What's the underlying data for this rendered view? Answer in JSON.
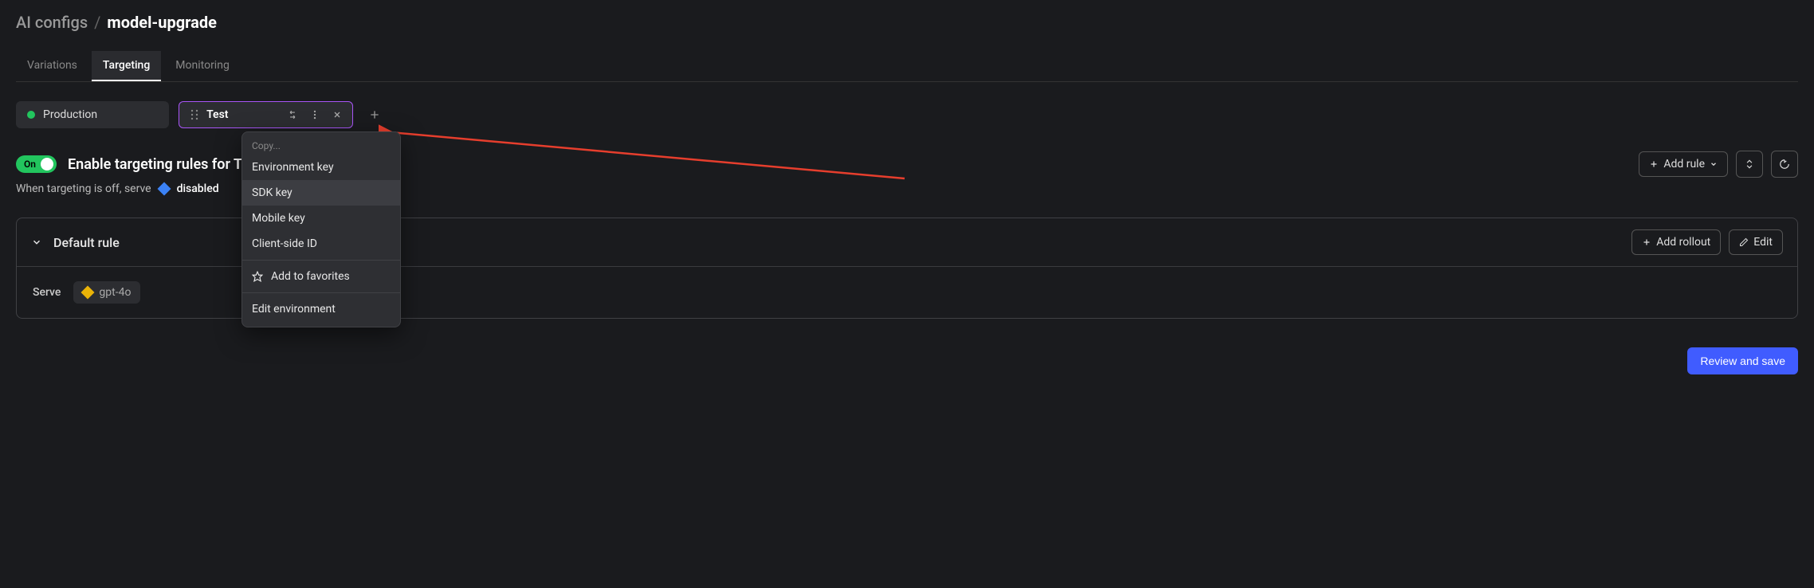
{
  "breadcrumb": {
    "parent": "AI configs",
    "sep": "/",
    "current": "model-upgrade"
  },
  "tabs": [
    {
      "label": "Variations",
      "active": false
    },
    {
      "label": "Targeting",
      "active": true
    },
    {
      "label": "Monitoring",
      "active": false
    }
  ],
  "environments": {
    "production": "Production",
    "test": "Test"
  },
  "context_menu": {
    "header": "Copy...",
    "items": [
      "Environment key",
      "SDK key",
      "Mobile key",
      "Client-side ID"
    ],
    "favorites": "Add to favorites",
    "edit_env": "Edit environment"
  },
  "targeting": {
    "toggle_label": "On",
    "title": "Enable targeting rules for Test",
    "off_serve_prefix": "When targeting is off, serve",
    "off_serve_value": "disabled"
  },
  "actions": {
    "add_rule": "Add rule",
    "add_rollout": "Add rollout",
    "edit": "Edit",
    "review_save": "Review and save"
  },
  "rule": {
    "title": "Default rule",
    "serve_label": "Serve",
    "serve_value": "gpt-4o"
  }
}
